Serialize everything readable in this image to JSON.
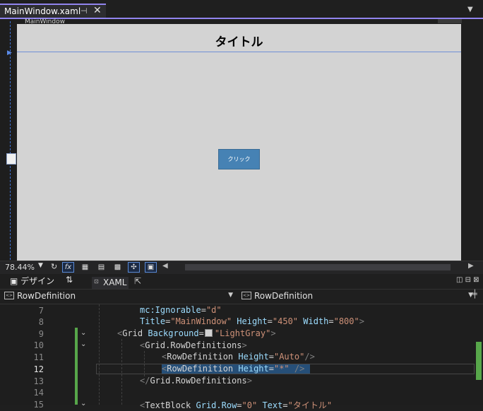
{
  "tab": {
    "title": "MainWindow.xaml",
    "pin": "⊣",
    "close": "✕"
  },
  "designer": {
    "window_label": "MainWindow",
    "title_text": "タイトル",
    "button_text": "クリック",
    "background": "#d3d3d3",
    "button_color": "#4682b4"
  },
  "zoom_toolbar": {
    "zoom": "78.44%",
    "fx": "fx"
  },
  "split_tabs": {
    "design": "デザイン",
    "swap": "⇅",
    "xaml": "XAML"
  },
  "nav": {
    "left": "RowDefinition",
    "right": "RowDefinition"
  },
  "editor": {
    "line_numbers": [
      "7",
      "8",
      "9",
      "10",
      "11",
      "12",
      "13",
      "14",
      "15"
    ],
    "lines": {
      "l7": {
        "attr": "mc:Ignorable",
        "eq": "=",
        "val": "\"d\""
      },
      "l8": {
        "a1": "Title",
        "v1": "\"MainWindow\"",
        "a2": "Height",
        "v2": "\"450\"",
        "a3": "Width",
        "v3": "\"800\"",
        "end": ">"
      },
      "l9": {
        "open": "<",
        "tag": "Grid",
        "attr": "Background",
        "eq": "=",
        "val": "\"LightGray\"",
        "close": ">"
      },
      "l10": {
        "open": "<",
        "tag": "Grid.RowDefinitions",
        "close": ">"
      },
      "l11": {
        "open": "<",
        "tag": "RowDefinition",
        "attr": "Height",
        "eq": "=",
        "val": "\"Auto\"",
        "close": "/>"
      },
      "l12": {
        "open": "<",
        "tag": "RowDefinition",
        "attr": "Height",
        "eq": "=",
        "val": "\"*\"",
        "close": "/>"
      },
      "l13": {
        "open": "</",
        "tag": "Grid.RowDefinitions",
        "close": ">"
      },
      "l15": {
        "open": "<",
        "tag": "TextBlock",
        "a1": "Grid.Row",
        "v1": "\"0\"",
        "a2": "Text",
        "v2": "\"タイトル\""
      }
    },
    "accent_green": "#57a64a",
    "selection_color": "#264f78"
  }
}
